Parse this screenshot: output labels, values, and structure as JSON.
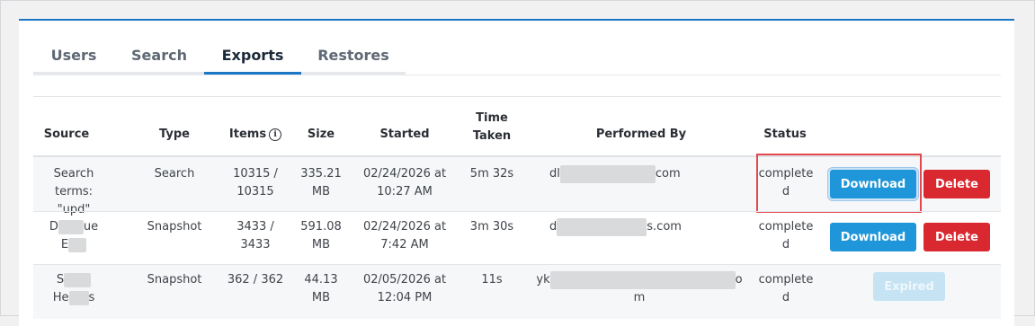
{
  "tabs": [
    {
      "label": "Users"
    },
    {
      "label": "Search"
    },
    {
      "label": "Exports"
    },
    {
      "label": "Restores"
    }
  ],
  "table": {
    "headers": {
      "source": "Source",
      "type": "Type",
      "items": "Items",
      "size": "Size",
      "started": "Started",
      "time_taken_1": "Time",
      "time_taken_2": "Taken",
      "performed_by": "Performed By",
      "status": "Status"
    },
    "rows": [
      {
        "source_1": "Search terms:",
        "source_2": "\"upd\"",
        "type": "Search",
        "items_1": "10315 /",
        "items_2": "10315",
        "size_1": "335.21",
        "size_2": "MB",
        "started_1": "02/24/2026 at",
        "started_2": "10:27 AM",
        "time_taken": "5m 32s",
        "performed_prefix": "dl",
        "performed_suffix": "com",
        "status_1": "complete",
        "status_2": "d",
        "download": "Download",
        "delete": "Delete"
      },
      {
        "source_1": "D",
        "source_1b": "ue",
        "source_2": "E",
        "type": "Snapshot",
        "items_1": "3433 /",
        "items_2": "3433",
        "size_1": "591.08",
        "size_2": "MB",
        "started_1": "02/24/2026 at",
        "started_2": "7:42 AM",
        "time_taken": "3m 30s",
        "performed_prefix": "d",
        "performed_suffix": "s.com",
        "status_1": "complete",
        "status_2": "d",
        "download": "Download",
        "delete": "Delete"
      },
      {
        "source_1": "S",
        "source_2": "He",
        "source_2b": "s",
        "type": "Snapshot",
        "items_1": "362 / 362",
        "size_1": "44.13",
        "size_2": "MB",
        "started_1": "02/05/2026 at",
        "started_2": "12:04 PM",
        "time_taken": "11s",
        "performed_prefix": "yk",
        "performed_suffix": "o",
        "performed_line2": "m",
        "status_1": "complete",
        "status_2": "d",
        "expired": "Expired"
      }
    ]
  }
}
